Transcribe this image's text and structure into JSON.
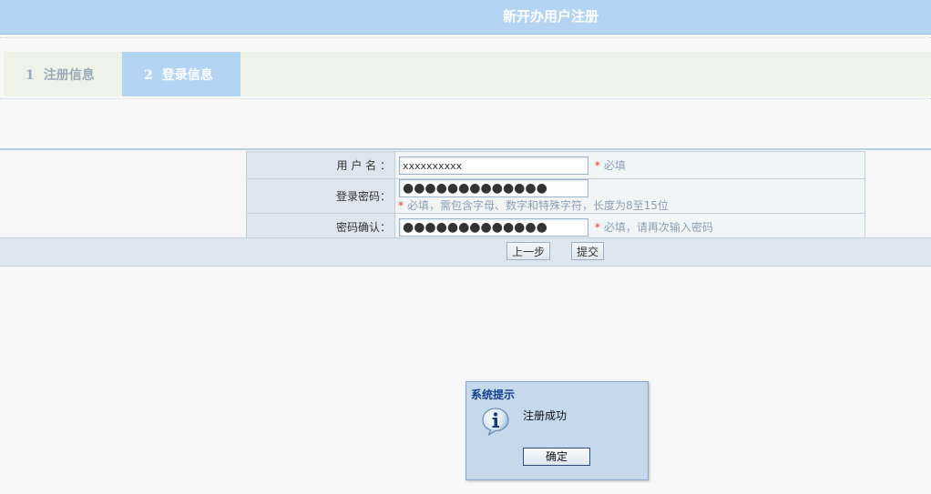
{
  "header": {
    "title": "新开办用户注册"
  },
  "steps": [
    {
      "num": "1",
      "label": "注册信息",
      "active": false
    },
    {
      "num": "2",
      "label": "登录信息",
      "active": true
    }
  ],
  "form": {
    "username": {
      "label": "用 户 名 ：",
      "value": "xxxxxxxxxx",
      "hint_star": "*",
      "hint": "必填"
    },
    "password": {
      "label": "登录密码：",
      "value": "●●●●●●●●●●●●●",
      "hint_star": "*",
      "hint": "必填，需包含字母、数字和特殊字符，长度为8至15位"
    },
    "confirm": {
      "label": "密码确认：",
      "value": "●●●●●●●●●●●●●",
      "hint_star": "*",
      "hint": "必填，请再次输入密码"
    }
  },
  "buttons": {
    "prev": "上一步",
    "submit": "提交"
  },
  "dialog": {
    "title": "系统提示",
    "message": "注册成功",
    "ok": "确定",
    "icon": "info-icon"
  },
  "colors": {
    "header_bg": "#b3d4f3",
    "active_step_bg": "#b3d4f3",
    "step_strip_bg": "#eff2e8",
    "required_star": "#ee3333"
  }
}
